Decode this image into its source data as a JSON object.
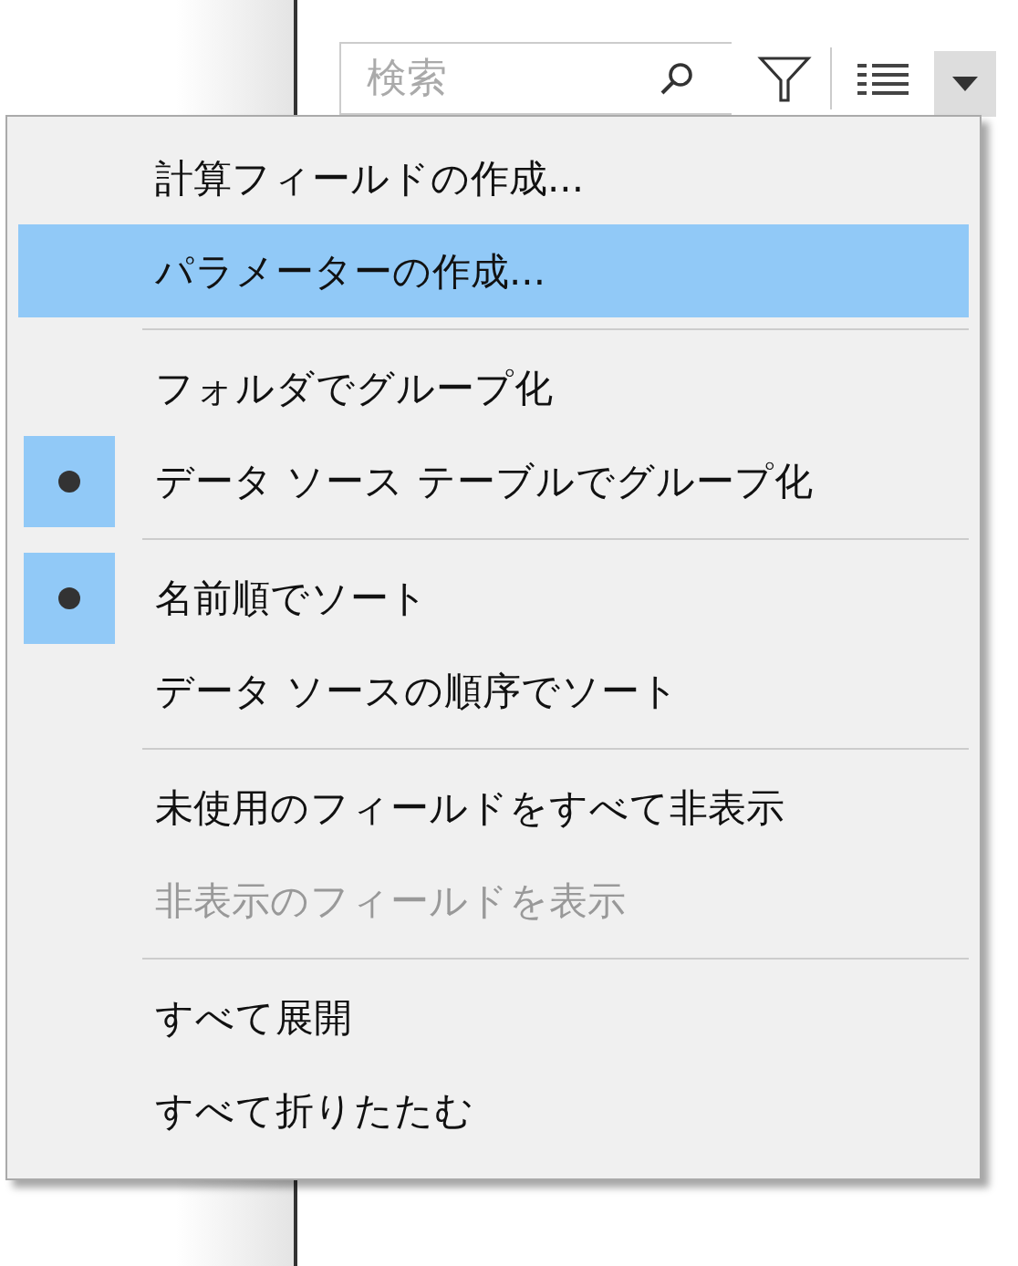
{
  "toolbar": {
    "search": {
      "placeholder": "検索"
    }
  },
  "menu": {
    "sections": [
      {
        "items": [
          {
            "label": "計算フィールドの作成...",
            "selected": false,
            "checked": false,
            "disabled": false
          },
          {
            "label": "パラメーターの作成...",
            "selected": true,
            "checked": false,
            "disabled": false
          }
        ]
      },
      {
        "items": [
          {
            "label": "フォルダでグループ化",
            "selected": false,
            "checked": false,
            "disabled": false
          },
          {
            "label": "データ ソース テーブルでグループ化",
            "selected": false,
            "checked": true,
            "disabled": false
          }
        ]
      },
      {
        "items": [
          {
            "label": "名前順でソート",
            "selected": false,
            "checked": true,
            "disabled": false
          },
          {
            "label": "データ ソースの順序でソート",
            "selected": false,
            "checked": false,
            "disabled": false
          }
        ]
      },
      {
        "items": [
          {
            "label": "未使用のフィールドをすべて非表示",
            "selected": false,
            "checked": false,
            "disabled": false
          },
          {
            "label": "非表示のフィールドを表示",
            "selected": false,
            "checked": false,
            "disabled": true
          }
        ]
      },
      {
        "items": [
          {
            "label": "すべて展開",
            "selected": false,
            "checked": false,
            "disabled": false
          },
          {
            "label": "すべて折りたたむ",
            "selected": false,
            "checked": false,
            "disabled": false
          }
        ]
      }
    ]
  }
}
